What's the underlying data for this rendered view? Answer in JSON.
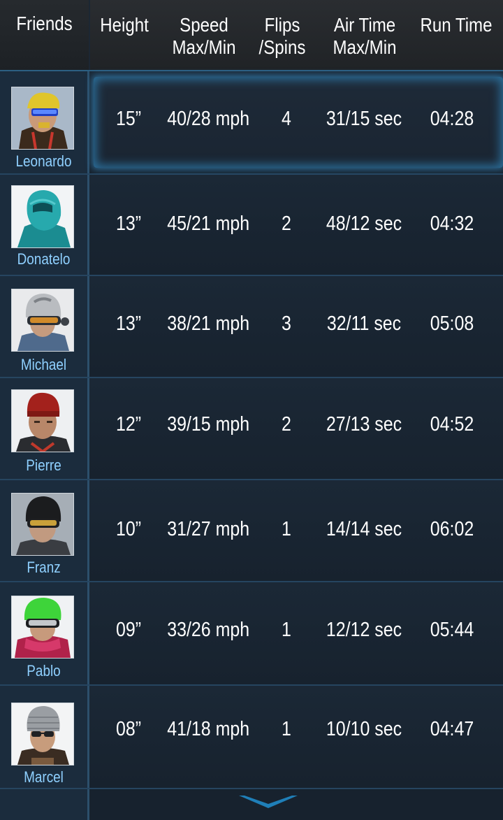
{
  "header": {
    "friends": "Friends",
    "height": "Height",
    "speed_line1": "Speed",
    "speed_line2": "Max/Min",
    "flips_line1": "Flips",
    "flips_line2": "/Spins",
    "air_line1": "Air Time",
    "air_line2": "Max/Min",
    "run_time": "Run Time"
  },
  "rows": [
    {
      "name": "Leonardo",
      "height": "15”",
      "speed": "40/28 mph",
      "flips": "4",
      "air": "31/15 sec",
      "run": "04:28",
      "avatar": "avatar-yellow-helmet-goggles",
      "selected": true
    },
    {
      "name": "Donatelo",
      "height": "13”",
      "speed": "45/21 mph",
      "flips": "2",
      "air": "48/12 sec",
      "run": "04:32",
      "avatar": "avatar-teal-hood"
    },
    {
      "name": "Michael",
      "height": "13”",
      "speed": "38/21 mph",
      "flips": "3",
      "air": "32/11 sec",
      "run": "05:08",
      "avatar": "avatar-grey-helmet-goggles"
    },
    {
      "name": "Pierre",
      "height": "12”",
      "speed": "39/15 mph",
      "flips": "2",
      "air": "27/13 sec",
      "run": "04:52",
      "avatar": "avatar-red-beanie"
    },
    {
      "name": "Franz",
      "height": "10”",
      "speed": "31/27 mph",
      "flips": "1",
      "air": "14/14 sec",
      "run": "06:02",
      "avatar": "avatar-black-helmet-goggles"
    },
    {
      "name": "Pablo",
      "height": "09”",
      "speed": "33/26 mph",
      "flips": "1",
      "air": "12/12 sec",
      "run": "05:44",
      "avatar": "avatar-green-helmet-goggles"
    },
    {
      "name": "Marcel",
      "height": "08”",
      "speed": "41/18 mph",
      "flips": "1",
      "air": "10/10 sec",
      "run": "04:47",
      "avatar": "avatar-grey-beanie-sunglasses"
    }
  ],
  "icons": {
    "scroll_down": "chevron-down-icon"
  },
  "colors": {
    "name_text": "#8fd0ff",
    "selected_glow": "#2f6f9a",
    "scroll_chevron": "#1f7fb8"
  }
}
